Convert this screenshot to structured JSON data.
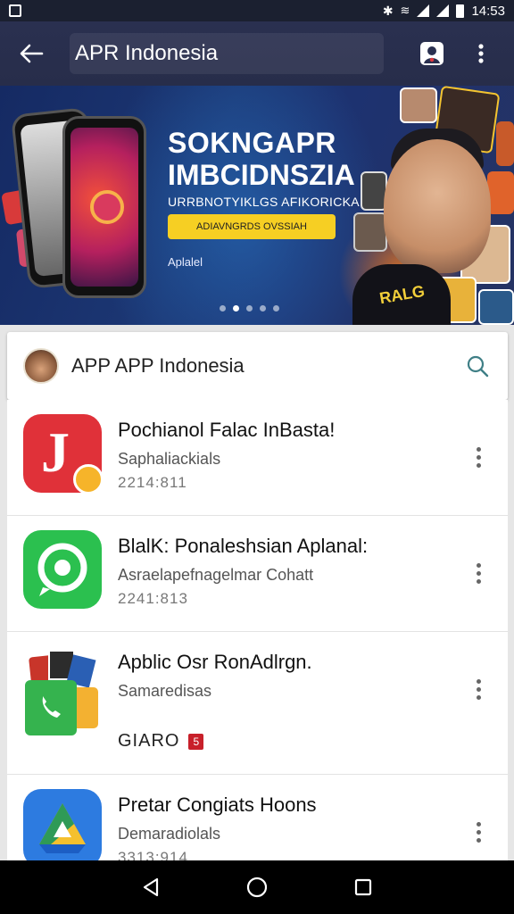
{
  "status_bar": {
    "time": "14:53"
  },
  "app_bar": {
    "title": "APR Indonesia"
  },
  "banner": {
    "line1": "SOKNGAPR",
    "line2": "IMBCIDNSZIA",
    "line3": "URRBNOTYIKLGS AFIKORICKA",
    "cta_label": "ADIAVNGRDS OVSSIAH",
    "small_text": "Aplalel",
    "shirt_text": "RALG",
    "page_count": 5,
    "active_page": 1
  },
  "search_card": {
    "title": "APP APP Indonesia"
  },
  "apps": [
    {
      "title": "Pochianol Falac InBasta!",
      "subtitle": "Saphaliackials",
      "meta": "2214:811",
      "icon": "red-j-icon",
      "icon_letter": "J"
    },
    {
      "title": "BlalK: Ponaleshsian Aplanal:",
      "subtitle": "Asraelapefnagelmar Cohatt",
      "meta": "2241:813",
      "icon": "green-chat-icon"
    },
    {
      "title": "Apblic Osr RonAdlrgn.",
      "subtitle": "Samaredisas",
      "meta": "",
      "badge_text": "GIARO",
      "badge_label": "5",
      "icon": "phone-collage-icon"
    },
    {
      "title": "Pretar Congiats Hoons",
      "subtitle": "Demaradiolals",
      "meta": "3313:914",
      "icon": "drive-triangle-icon"
    }
  ],
  "colors": {
    "app_bar": "#2a3050",
    "banner_bg": "#1c3774",
    "cta": "#f6cf23",
    "red_icon": "#e03139",
    "green_icon": "#2bc04f",
    "blue_icon": "#2d7be0"
  }
}
